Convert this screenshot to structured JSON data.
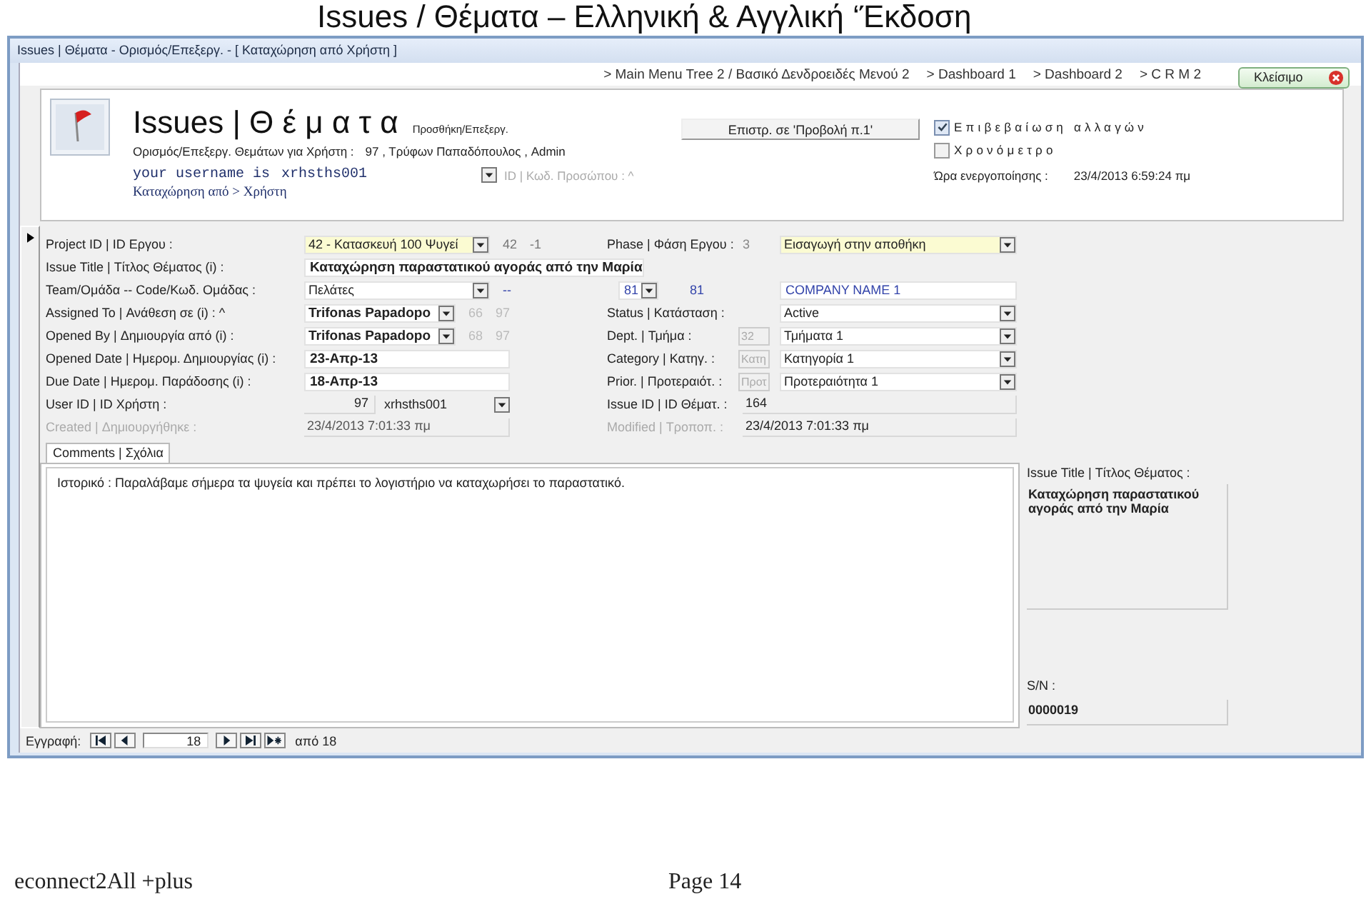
{
  "document": {
    "heading": "Issues / Θέματα – Ελληνική & Αγγλική ‘Έκδοση",
    "footer_left": "econnect2All +plus",
    "footer_page": "Page 14"
  },
  "window": {
    "title": "Issues | Θέματα - Ορισμός/Επεξεργ. - [ Καταχώρηση από Χρήστη ]"
  },
  "nav_links": [
    "> Main Menu Tree 2 / Βασικό Δενδροειδές Μενού 2",
    "> Dashboard 1",
    "> Dashboard 2",
    "> C R M 2"
  ],
  "close_button": "Κλείσιμο",
  "header": {
    "title": "Issues | Θ έ μ α τ α",
    "mode": "Προσθήκη/Επεξεργ.",
    "subtitle_label": "Ορισμός/Επεξεργ. Θεμάτων για Χρήστη :",
    "subtitle_value": "97 , Τρύφων Παπαδόπουλος , Admin",
    "username_label": "your username is",
    "username": "xrhsths001",
    "person_id_label": "ID | Κωδ. Προσώπου : ^",
    "breadcrumb": "Καταχώρηση από > Χρήστη",
    "return_button": "Επιστρ. σε 'Προβολή π.1'",
    "checkboxes": [
      {
        "label": "Επιβεβαίωση αλλαγών",
        "checked": true
      },
      {
        "label": "Χρονόμετρο",
        "checked": false
      }
    ],
    "activation_label": "Ώρα ενεργοποίησης :",
    "activation_time": "23/4/2013 6:59:24 πμ"
  },
  "rows": [
    {
      "label": "Project ID | ID Εργου :",
      "label_disabled": false,
      "value": {
        "kind": "combo",
        "text": "42 - Κατασκευή 100 Ψυγεί",
        "bold": false,
        "highlight": true
      },
      "extras": [
        {
          "text": "42",
          "color": "#777777"
        },
        {
          "text": "-1",
          "color": "#777777"
        }
      ],
      "right": {
        "label": "Phase | Φάση Εργου :",
        "label_disabled": false,
        "code": {
          "text": "3",
          "boxed": false
        },
        "value": {
          "kind": "combo",
          "text": "Εισαγωγή στην αποθήκη",
          "highlight": true
        }
      }
    },
    {
      "label": "Issue Title | Τίτλος Θέματος (i) :",
      "label_disabled": false,
      "value": {
        "kind": "wide",
        "text": "Καταχώρηση παραστατικού αγοράς από την Μαρία",
        "bold": true,
        "highlight": false
      }
    },
    {
      "label": "Team/Ομάδα -- Code/Κωδ. Ομάδας :",
      "label_disabled": false,
      "value": {
        "kind": "combo",
        "text": "Πελάτες",
        "bold": false,
        "highlight": false
      },
      "extras": [
        {
          "text": "--",
          "color": "#3344aa"
        }
      ],
      "team": {
        "code": "81",
        "code_echo": "81",
        "name": "COMPANY NAME 1"
      }
    },
    {
      "label": "Assigned To | Ανάθεση σε (i) : ^",
      "label_disabled": false,
      "value": {
        "kind": "combo",
        "text": "Trifonas Papadopo",
        "bold": true,
        "highlight": false
      },
      "extras": [
        {
          "text": "66",
          "color": "#bbbbbb"
        },
        {
          "text": "97",
          "color": "#bbbbbb"
        }
      ],
      "right": {
        "label": "Status | Κατάσταση :",
        "label_disabled": false,
        "value": {
          "kind": "combo",
          "text": "Active",
          "highlight": false
        }
      }
    },
    {
      "label": "Opened By | Δημιουργία από (i) :",
      "label_disabled": false,
      "value": {
        "kind": "combo",
        "text": "Trifonas Papadopo",
        "bold": true,
        "highlight": false
      },
      "extras": [
        {
          "text": "68",
          "color": "#bbbbbb"
        },
        {
          "text": "97",
          "color": "#bbbbbb"
        }
      ],
      "right": {
        "label": "Dept. | Τμήμα :",
        "label_disabled": false,
        "code": {
          "text": "32",
          "boxed": true
        },
        "value": {
          "kind": "combo",
          "text": "Τμήματα 1",
          "highlight": false
        }
      }
    },
    {
      "label": "Opened Date | Ημερομ. Δημιουργίας (i) :",
      "label_disabled": false,
      "value": {
        "kind": "field",
        "text": "23-Απρ-13",
        "bold": true,
        "highlight": false
      },
      "right": {
        "label": "Category | Κατηγ. :",
        "label_disabled": false,
        "code": {
          "text": "Κατη",
          "boxed": true
        },
        "value": {
          "kind": "combo",
          "text": "Κατηγορία 1",
          "highlight": false
        }
      }
    },
    {
      "label": "Due Date | Ημερομ. Παράδοσης (i) :",
      "label_disabled": false,
      "value": {
        "kind": "field",
        "text": "18-Απρ-13",
        "bold": true,
        "highlight": false
      },
      "right": {
        "label": "Prior. | Προτεραιότ. :",
        "label_disabled": false,
        "code": {
          "text": "Προτ",
          "boxed": true
        },
        "value": {
          "kind": "combo",
          "text": "Προτεραιότητα 1",
          "highlight": false
        }
      }
    },
    {
      "label": "User ID | ID Χρήστη :",
      "label_disabled": false,
      "value": {
        "kind": "id-combo",
        "number": "97",
        "text": "xrhsths001",
        "bold": false
      },
      "right": {
        "label": "Issue ID | ID Θέματ. :",
        "label_disabled": false,
        "value": {
          "kind": "readonly",
          "text": "164",
          "highlight": false
        }
      }
    },
    {
      "label": "Created | Δημιουργήθηκε :",
      "label_disabled": true,
      "value": {
        "kind": "readonly",
        "text": "23/4/2013 7:01:33 πμ",
        "bold": false,
        "highlight": false
      },
      "right": {
        "label": "Modified | Τροποπ. :",
        "label_disabled": true,
        "value": {
          "kind": "readonly",
          "text": "23/4/2013 7:01:33 πμ",
          "highlight": false
        }
      }
    }
  ],
  "tabs": [
    {
      "label": "Comments | Σχόλια",
      "selected": true
    }
  ],
  "comment": "Ιστορικό : Παραλάβαμε σήμερα τα ψυγεία και πρέπει το λογιστήριο να καταχωρήσει το παραστατικό.",
  "side": {
    "title_label": "Issue Title | Τίτλος Θέματος :",
    "title_value": "Καταχώρηση παραστατικού αγοράς από την Μαρία",
    "sn_label": "S/N :",
    "sn_value": "0000019"
  },
  "record_nav": {
    "label": "Εγγραφή:",
    "current": "18",
    "total": "από 18"
  }
}
